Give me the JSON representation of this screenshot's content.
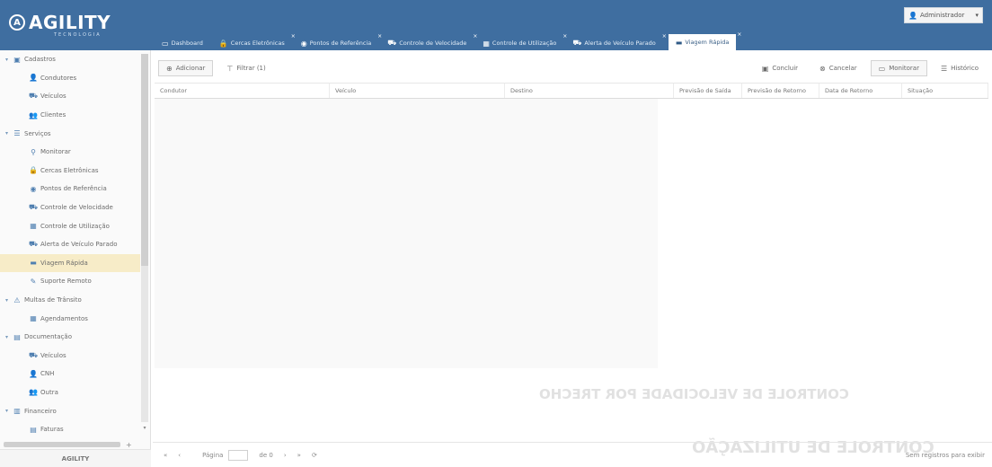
{
  "header": {
    "logo_mark": "A",
    "logo_text": "AGILITY",
    "logo_sub": "TECNOLOGIA",
    "user_icon": "user-icon",
    "user_label": "Administrador",
    "user_caret": "▾"
  },
  "tabs": [
    {
      "icon": "desktop-icon",
      "glyph": "▭",
      "label": "Dashboard"
    },
    {
      "icon": "lock-icon",
      "glyph": "🔒",
      "label": "Cercas Eletrônicas",
      "close": "×"
    },
    {
      "icon": "globe-icon",
      "glyph": "◉",
      "label": "Pontos de Referência",
      "close": "×"
    },
    {
      "icon": "car-icon",
      "glyph": "⛟",
      "label": "Controle de Velocidade",
      "close": "×"
    },
    {
      "icon": "calendar-icon",
      "glyph": "▦",
      "label": "Controle de Utilização",
      "close": "×"
    },
    {
      "icon": "car-icon",
      "glyph": "⛟",
      "label": "Alerta de Veículo Parado",
      "close": "×"
    },
    {
      "icon": "briefcase-icon",
      "glyph": "▬",
      "label": "Viagem Rápida",
      "close": "×",
      "active": true
    }
  ],
  "sidebar": {
    "items": [
      {
        "type": "group",
        "chev": "▾",
        "glyph": "▣",
        "icon": "cadastros-icon",
        "label": "Cadastros"
      },
      {
        "type": "child",
        "glyph": "👤",
        "icon": "driver-icon",
        "label": "Condutores"
      },
      {
        "type": "child",
        "glyph": "⛟",
        "icon": "vehicle-icon",
        "label": "Veículos"
      },
      {
        "type": "child",
        "glyph": "👥",
        "icon": "clients-icon",
        "label": "Clientes"
      },
      {
        "type": "group",
        "chev": "▾",
        "glyph": "☰",
        "icon": "services-icon",
        "label": "Serviços"
      },
      {
        "type": "child",
        "glyph": "⚲",
        "icon": "pin-icon",
        "label": "Monitorar"
      },
      {
        "type": "child",
        "glyph": "🔒",
        "icon": "lock-icon",
        "label": "Cercas Eletrônicas"
      },
      {
        "type": "child",
        "glyph": "◉",
        "icon": "globe-icon",
        "label": "Pontos de Referência"
      },
      {
        "type": "child",
        "glyph": "⛟",
        "icon": "car-icon",
        "label": "Controle de Velocidade"
      },
      {
        "type": "child",
        "glyph": "▦",
        "icon": "calendar-icon",
        "label": "Controle de Utilização"
      },
      {
        "type": "child",
        "glyph": "⛟",
        "icon": "car-icon",
        "label": "Alerta de Veículo Parado"
      },
      {
        "type": "child",
        "glyph": "▬",
        "icon": "briefcase-icon",
        "label": "Viagem Rápida",
        "active": true
      },
      {
        "type": "child",
        "glyph": "✎",
        "icon": "support-icon",
        "label": "Suporte Remoto"
      },
      {
        "type": "group",
        "chev": "▾",
        "glyph": "⚠",
        "icon": "traffic-icon",
        "label": "Multas de Trânsito"
      },
      {
        "type": "child",
        "glyph": "▦",
        "icon": "calendar-icon",
        "label": "Agendamentos"
      },
      {
        "type": "group",
        "chev": "▾",
        "glyph": "▤",
        "icon": "document-icon",
        "label": "Documentação"
      },
      {
        "type": "child",
        "glyph": "⛟",
        "icon": "vehicle-icon",
        "label": "Veículos"
      },
      {
        "type": "child",
        "glyph": "👤",
        "icon": "user-icon",
        "label": "CNH"
      },
      {
        "type": "child",
        "glyph": "👥",
        "icon": "users-icon",
        "label": "Outra"
      },
      {
        "type": "group",
        "chev": "▾",
        "glyph": "▥",
        "icon": "finance-icon",
        "label": "Financeiro"
      },
      {
        "type": "child",
        "glyph": "▤",
        "icon": "invoice-icon",
        "label": "Faturas"
      }
    ],
    "footer": "AGILITY",
    "scroll_plus": "+",
    "scroll_down": "▾"
  },
  "toolbar": {
    "add_label": "Adicionar",
    "add_glyph": "⊕",
    "filter_label": "Filtrar (1)",
    "filter_glyph": "⊤",
    "conclude_label": "Concluir",
    "conclude_glyph": "▣",
    "cancel_label": "Cancelar",
    "cancel_glyph": "⊗",
    "monitor_label": "Monitorar",
    "monitor_glyph": "▭",
    "history_label": "Histórico",
    "history_glyph": "☰"
  },
  "grid": {
    "columns": [
      {
        "label": "Condutor",
        "w": 195
      },
      {
        "label": "Veículo",
        "w": 195
      },
      {
        "label": "Destino",
        "w": 188
      },
      {
        "label": "Previsão de Saída",
        "w": 76
      },
      {
        "label": "Previsão de Retorno",
        "w": 86
      },
      {
        "label": "Data de Retorno",
        "w": 92
      },
      {
        "label": "Situação",
        "w": 96
      }
    ]
  },
  "pager": {
    "first": "«",
    "prev": "‹",
    "page_label": "Página",
    "of_label": "de 0",
    "next": "›",
    "last": "»",
    "refresh": "⟳",
    "empty_text": "Sem registros para exibir"
  },
  "ghost": {
    "line1": "CONTROLE DE VELOCIDADE POR TRECHO",
    "line2": "CONTROLE DE UTILIZAÇÃO"
  }
}
